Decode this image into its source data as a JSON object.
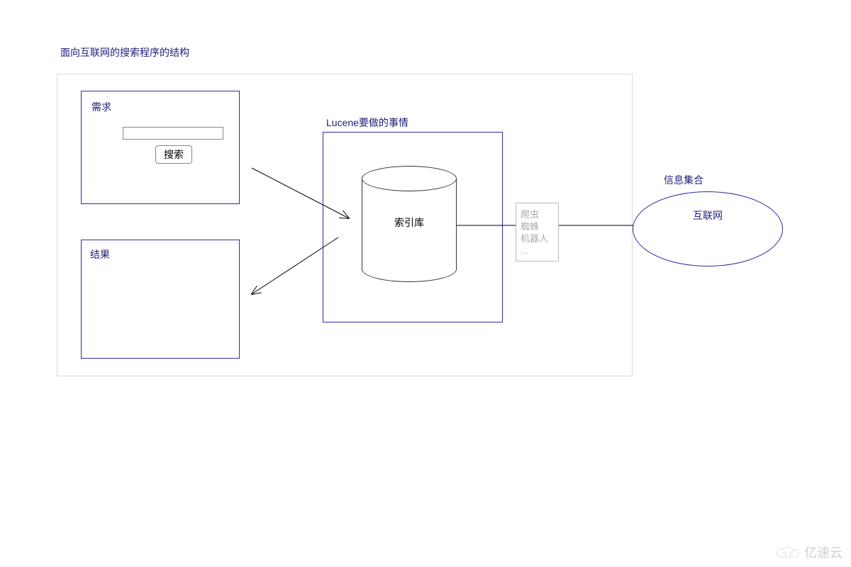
{
  "title": "面向互联网的搜索程序的结构",
  "demand": {
    "label": "需求",
    "search_button": "搜索"
  },
  "result": {
    "label": "结果"
  },
  "lucene": {
    "label": "Lucene要做的事情",
    "index_store": "索引库"
  },
  "crawler": {
    "line1": "爬虫",
    "line2": "蜘蛛",
    "line3": "机器人",
    "line4": "..."
  },
  "info_collection": {
    "label": "信息集合",
    "internet": "互联网"
  },
  "watermark": "亿速云"
}
